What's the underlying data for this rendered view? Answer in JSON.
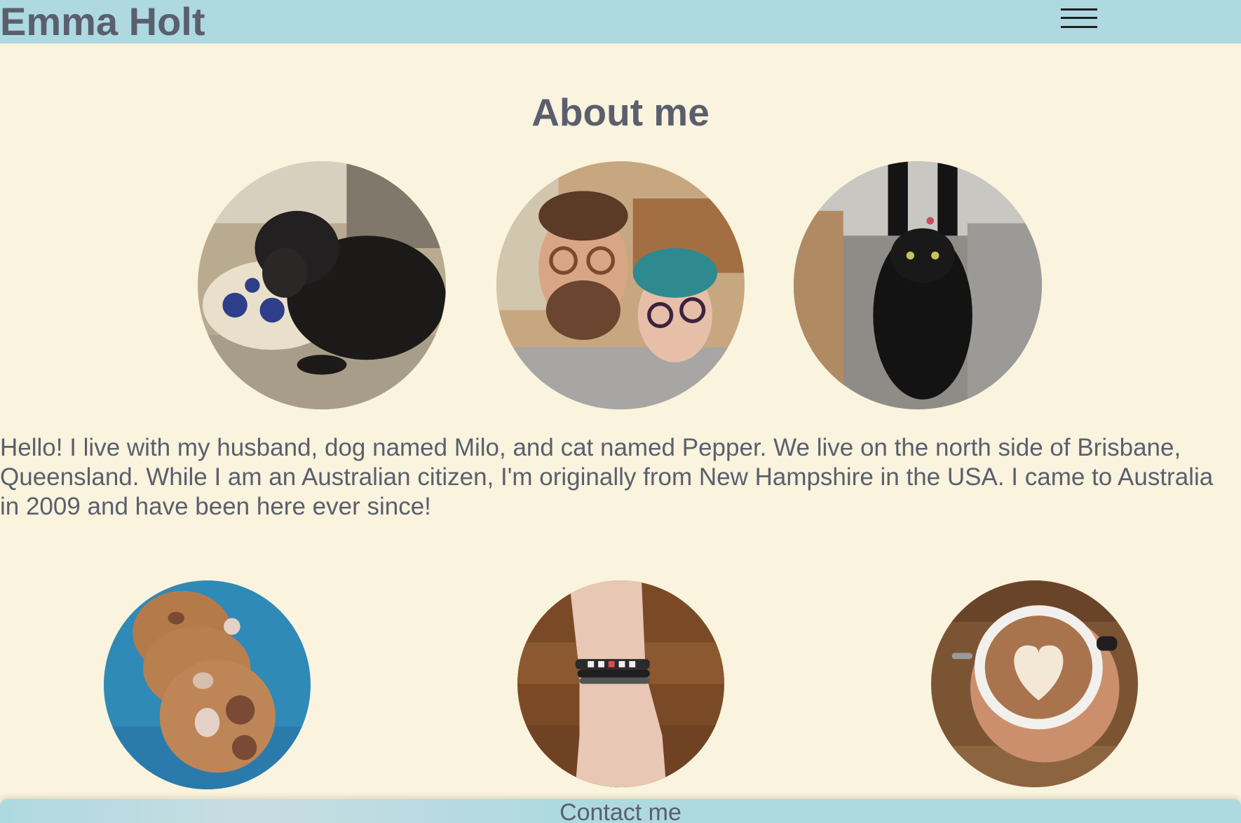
{
  "header": {
    "site_title": "Emma Holt",
    "menu_icon": "hamburger-menu-icon"
  },
  "main": {
    "heading": "About me",
    "bio": "Hello! I live with my husband, dog named Milo, and cat named Pepper. We live on the north side of Brisbane, Queensland. While I am an Australian citizen, I'm originally from New Hampshire in the USA. I came to Australia in 2009 and have been here ever since!"
  },
  "footer": {
    "contact_label": "Contact me"
  },
  "colors": {
    "background": "#faf3dd",
    "bar": "#aed9e0",
    "text": "#5a5f6e"
  }
}
